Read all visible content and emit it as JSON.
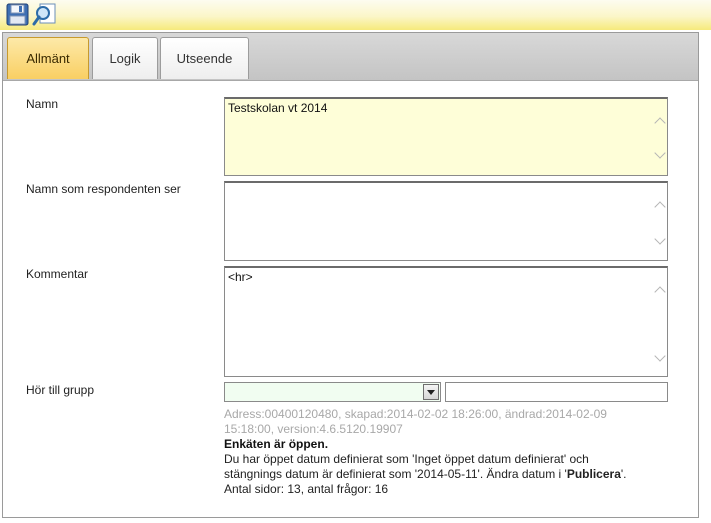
{
  "toolbar": {
    "save_icon": "floppy-disk-icon",
    "search_icon": "magnifier-icon",
    "colors": {
      "gradient_top": "#fdfcf0",
      "gradient_bottom": "#f6ea7c"
    }
  },
  "tabs": [
    {
      "label": "Allmänt",
      "active": true
    },
    {
      "label": "Logik",
      "active": false
    },
    {
      "label": "Utseende",
      "active": false
    }
  ],
  "form": {
    "name": {
      "label": "Namn",
      "value": "Testskolan vt 2014",
      "bg": "#fefed8"
    },
    "respondent_name": {
      "label": "Namn som respondenten ser",
      "value": ""
    },
    "comment": {
      "label": "Kommentar",
      "value": "<hr>"
    },
    "group": {
      "label": "Hör till grupp",
      "selected": "",
      "text_value": ""
    }
  },
  "info": {
    "meta_line1": "Adress:00400120480, skapad:2014-02-02 18:26:00, ändrad:2014-02-09",
    "meta_line2": "15:18:00, version:4.6.5120.19907",
    "status": "Enkäten är öppen.",
    "date_line1": "Du har öppet datum definierat som 'Inget öppet datum definierat' och",
    "date_line2_prefix": "stängnings datum är definierat som '2014-05-11'. Ändra datum i '",
    "date_line2_link": "Publicera",
    "date_line2_suffix": "'.",
    "counts": "Antal sidor: 13, antal frågor: 16"
  }
}
